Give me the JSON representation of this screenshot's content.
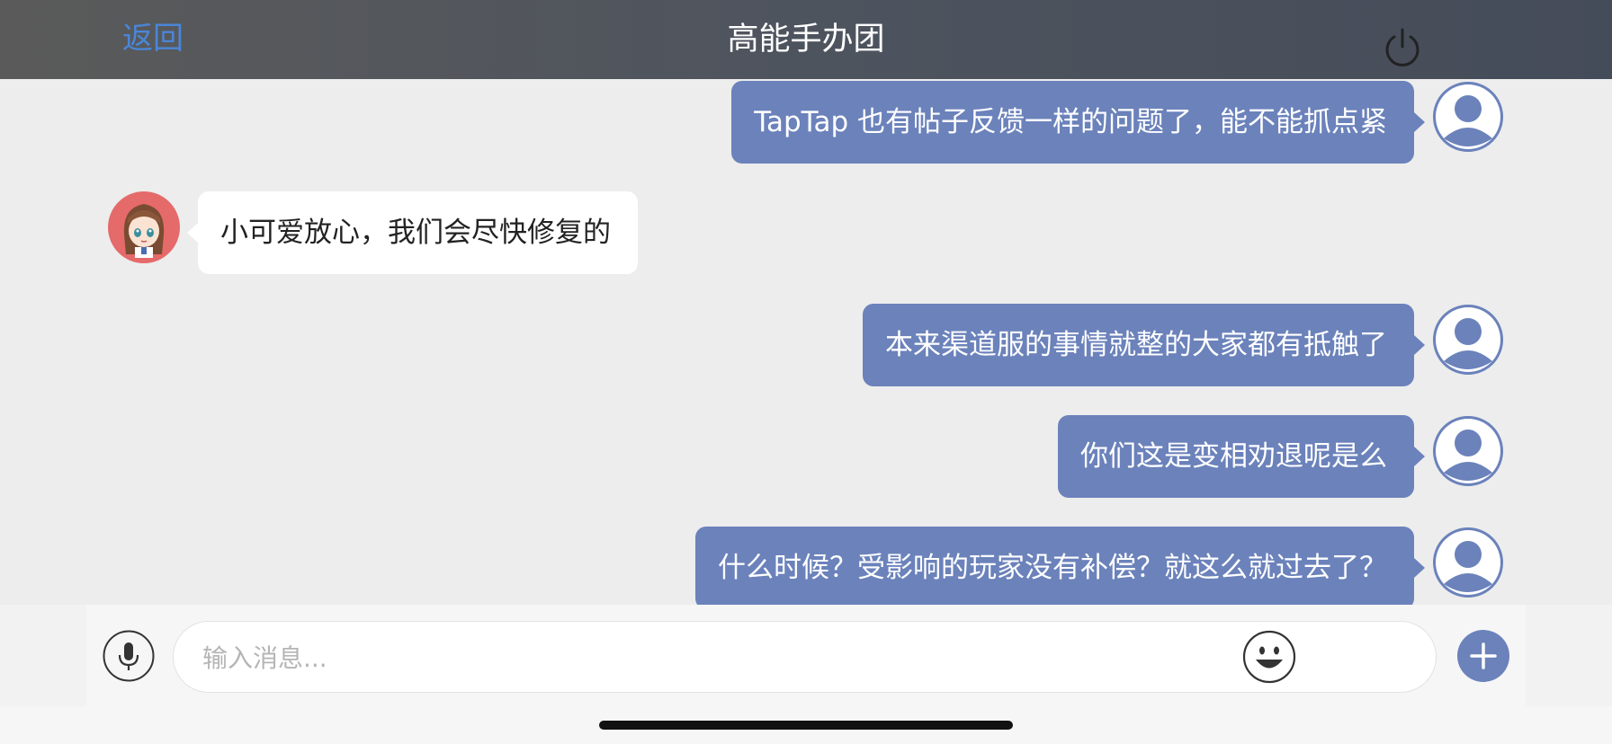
{
  "header": {
    "back_label": "返回",
    "title": "高能手办团",
    "power_icon": "power-icon"
  },
  "messages": [
    {
      "side": "right",
      "text": "TapTap 也有帖子反馈一样的问题了，能不能抓点紧"
    },
    {
      "side": "left",
      "text": "小可爱放心，我们会尽快修复的"
    },
    {
      "side": "right",
      "text": "本来渠道服的事情就整的大家都有抵触了"
    },
    {
      "side": "right",
      "text": "你们这是变相劝退呢是么"
    },
    {
      "side": "right",
      "text": "什么时候？受影响的玩家没有补偿？就这么就过去了？"
    }
  ],
  "input": {
    "placeholder": "输入消息...",
    "value": ""
  },
  "icons": {
    "mic": "microphone-icon",
    "emoji": "smiley-icon",
    "plus": "plus-icon",
    "user_avatar": "user-avatar-icon",
    "bot_avatar": "anime-girl-avatar"
  },
  "colors": {
    "accent": "#4a86d8",
    "user_bubble": "#6b82bb",
    "bot_bubble": "#ffffff",
    "header_bg": "#4e545e",
    "chat_bg": "#ededed"
  }
}
